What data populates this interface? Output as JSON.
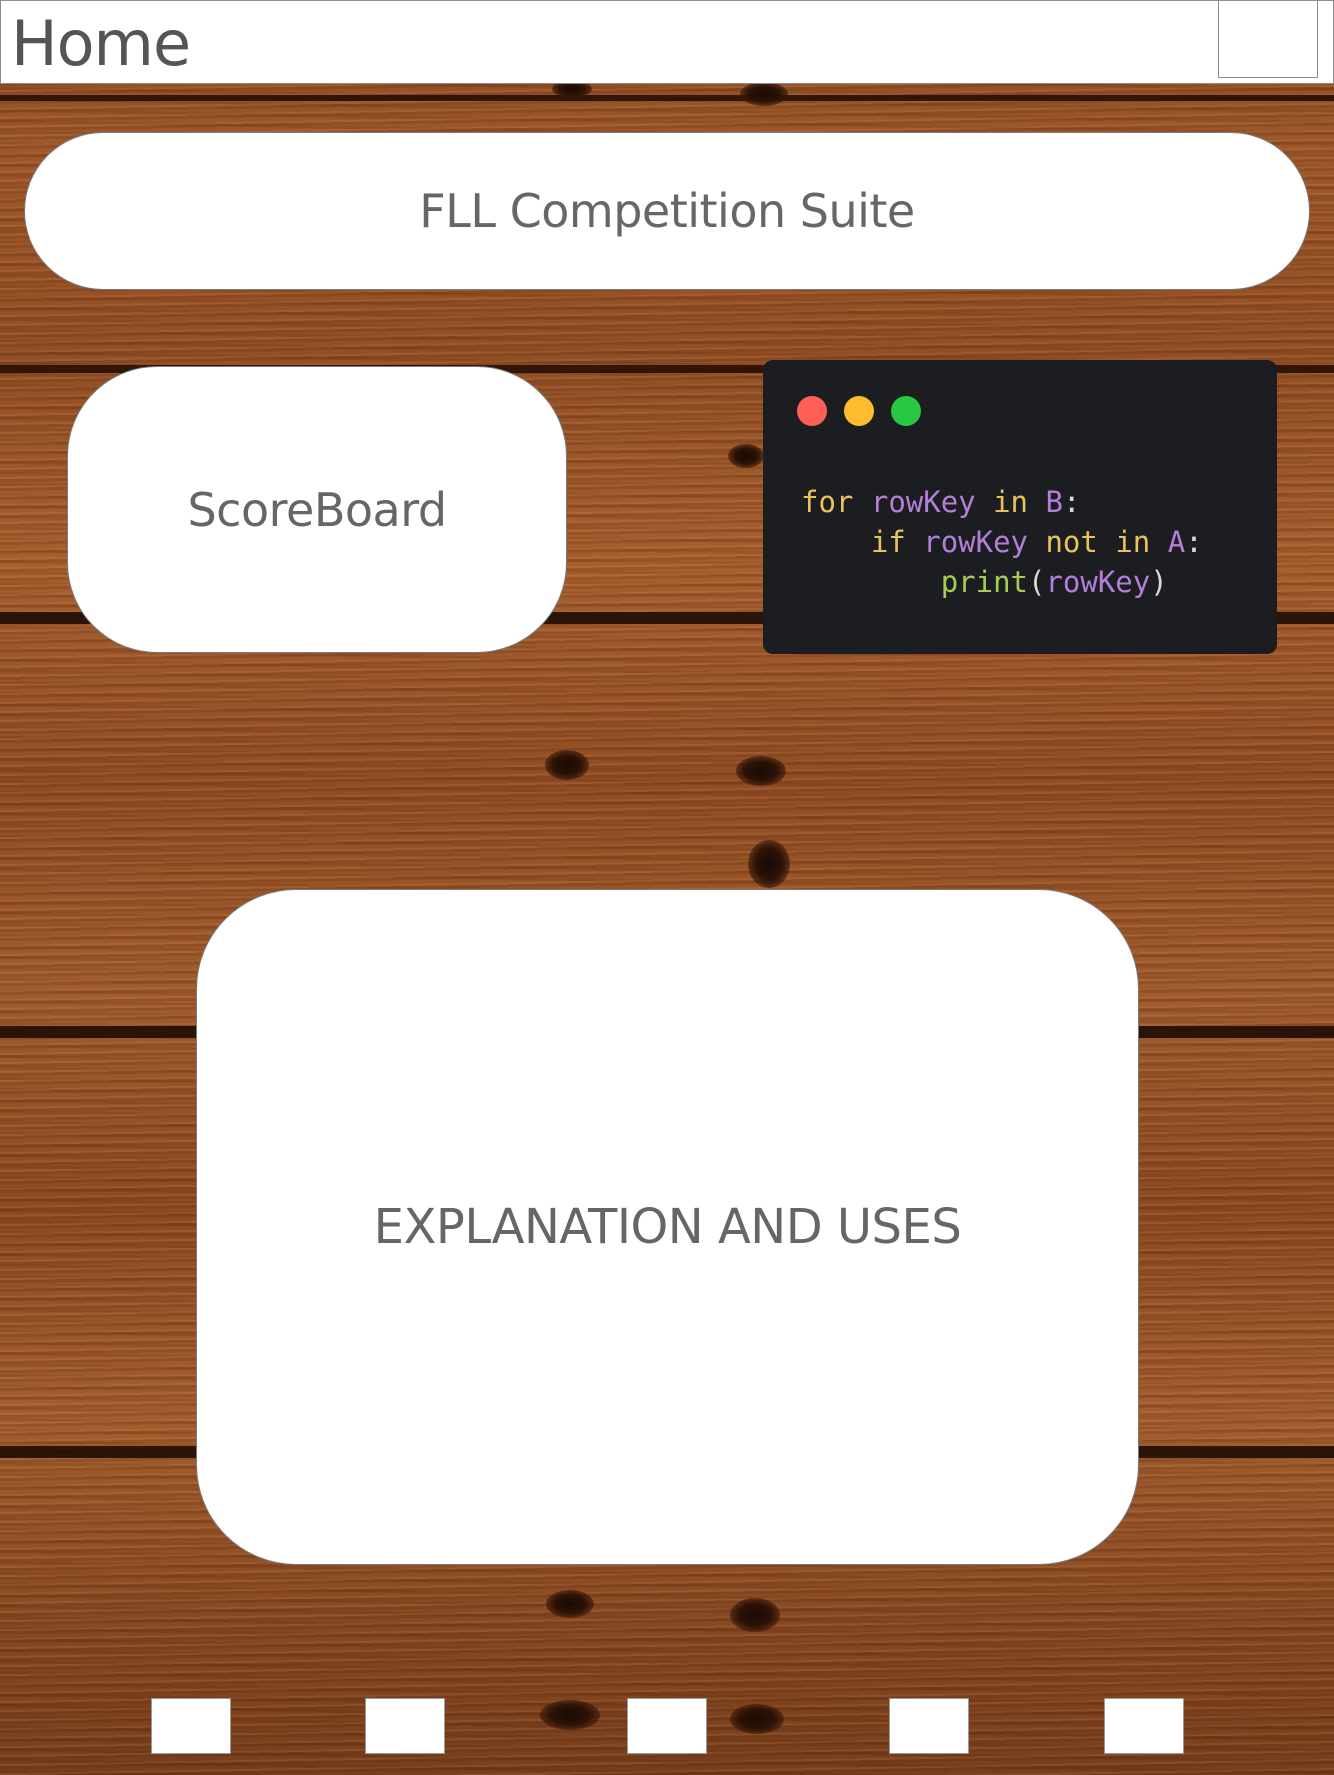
{
  "header": {
    "title": "Home"
  },
  "banner": {
    "title": "FLL Competition Suite"
  },
  "scoreboard": {
    "label": "ScoreBoard"
  },
  "code_window": {
    "dots": [
      "#ff5f57",
      "#febc2e",
      "#28c840"
    ],
    "lines": [
      "for rowKey in B:",
      "    if rowKey not in A:",
      "        print(rowKey)"
    ],
    "tokens": {
      "for": "for",
      "in": "in",
      "if": "if",
      "not": "not",
      "rowKey": "rowKey",
      "B": "B",
      "A": "A",
      "print": "print",
      "colon": ":",
      "lparen": "(",
      "rparen": ")"
    }
  },
  "explanation": {
    "label": "EXPLANATION AND USES"
  },
  "bottom_nav": {
    "count": 5
  }
}
